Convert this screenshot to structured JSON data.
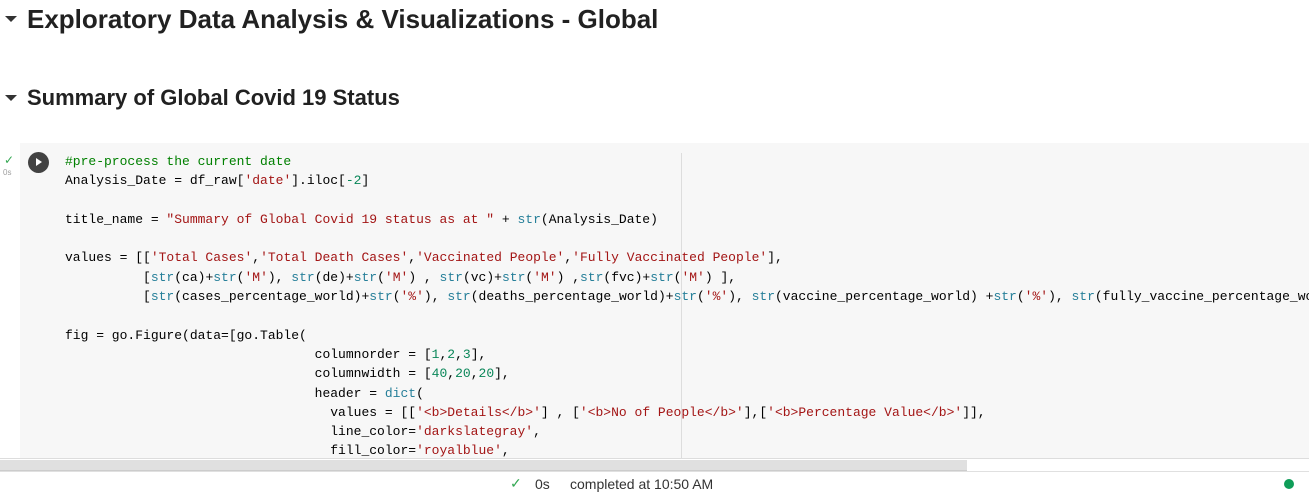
{
  "headings": {
    "h1": "Exploratory Data Analysis & Visualizations - Global",
    "h2": "Summary of Global Covid 19 Status"
  },
  "cell": {
    "status_icon": "check-icon",
    "status_check": "✓",
    "exec_time": "0s",
    "run_icon": "play-icon",
    "code_lines": [
      [
        [
          "c",
          "#pre-process the current date"
        ]
      ],
      [
        [
          "p",
          "Analysis_Date = df_raw["
        ],
        [
          "s",
          "'date'"
        ],
        [
          "p",
          "].iloc["
        ],
        [
          "n",
          "-2"
        ],
        [
          "p",
          "]"
        ]
      ],
      [],
      [
        [
          "p",
          "title_name = "
        ],
        [
          "s",
          "\"Summary of Global Covid 19 status as at \""
        ],
        [
          "p",
          " + "
        ],
        [
          "b",
          "str"
        ],
        [
          "p",
          "(Analysis_Date)"
        ]
      ],
      [],
      [
        [
          "p",
          "values = [["
        ],
        [
          "s",
          "'Total Cases'"
        ],
        [
          "p",
          ","
        ],
        [
          "s",
          "'Total Death Cases'"
        ],
        [
          "p",
          ","
        ],
        [
          "s",
          "'Vaccinated People'"
        ],
        [
          "p",
          ","
        ],
        [
          "s",
          "'Fully Vaccinated People'"
        ],
        [
          "p",
          "],"
        ]
      ],
      [
        [
          "p",
          "          ["
        ],
        [
          "b",
          "str"
        ],
        [
          "p",
          "(ca)+"
        ],
        [
          "b",
          "str"
        ],
        [
          "p",
          "("
        ],
        [
          "s",
          "'M'"
        ],
        [
          "p",
          "), "
        ],
        [
          "b",
          "str"
        ],
        [
          "p",
          "(de)+"
        ],
        [
          "b",
          "str"
        ],
        [
          "p",
          "("
        ],
        [
          "s",
          "'M'"
        ],
        [
          "p",
          ") , "
        ],
        [
          "b",
          "str"
        ],
        [
          "p",
          "(vc)+"
        ],
        [
          "b",
          "str"
        ],
        [
          "p",
          "("
        ],
        [
          "s",
          "'M'"
        ],
        [
          "p",
          ") ,"
        ],
        [
          "b",
          "str"
        ],
        [
          "p",
          "(fvc)+"
        ],
        [
          "b",
          "str"
        ],
        [
          "p",
          "("
        ],
        [
          "s",
          "'M'"
        ],
        [
          "p",
          ") ],"
        ]
      ],
      [
        [
          "p",
          "          ["
        ],
        [
          "b",
          "str"
        ],
        [
          "p",
          "(cases_percentage_world)+"
        ],
        [
          "b",
          "str"
        ],
        [
          "p",
          "("
        ],
        [
          "s",
          "'%'"
        ],
        [
          "p",
          "), "
        ],
        [
          "b",
          "str"
        ],
        [
          "p",
          "(deaths_percentage_world)+"
        ],
        [
          "b",
          "str"
        ],
        [
          "p",
          "("
        ],
        [
          "s",
          "'%'"
        ],
        [
          "p",
          "), "
        ],
        [
          "b",
          "str"
        ],
        [
          "p",
          "(vaccine_percentage_world) +"
        ],
        [
          "b",
          "str"
        ],
        [
          "p",
          "("
        ],
        [
          "s",
          "'%'"
        ],
        [
          "p",
          "), "
        ],
        [
          "b",
          "str"
        ],
        [
          "p",
          "(fully_vaccine_percentage_wor"
        ]
      ],
      [],
      [
        [
          "p",
          "fig = go.Figure(data=[go.Table("
        ]
      ],
      [
        [
          "p",
          "                                columnorder = ["
        ],
        [
          "n",
          "1"
        ],
        [
          "p",
          ","
        ],
        [
          "n",
          "2"
        ],
        [
          "p",
          ","
        ],
        [
          "n",
          "3"
        ],
        [
          "p",
          "],"
        ]
      ],
      [
        [
          "p",
          "                                columnwidth = ["
        ],
        [
          "n",
          "40"
        ],
        [
          "p",
          ","
        ],
        [
          "n",
          "20"
        ],
        [
          "p",
          ","
        ],
        [
          "n",
          "20"
        ],
        [
          "p",
          "],"
        ]
      ],
      [
        [
          "p",
          "                                header = "
        ],
        [
          "b",
          "dict"
        ],
        [
          "p",
          "("
        ]
      ],
      [
        [
          "p",
          "                                  values = [["
        ],
        [
          "s",
          "'<b>Details</b>'"
        ],
        [
          "p",
          "] , ["
        ],
        [
          "s",
          "'<b>No of People</b>'"
        ],
        [
          "p",
          "],["
        ],
        [
          "s",
          "'<b>Percentage Value</b>'"
        ],
        [
          "p",
          "]],"
        ]
      ],
      [
        [
          "p",
          "                                  line_color="
        ],
        [
          "s",
          "'darkslategray'"
        ],
        [
          "p",
          ","
        ]
      ],
      [
        [
          "p",
          "                                  fill_color="
        ],
        [
          "s",
          "'royalblue'"
        ],
        [
          "p",
          ","
        ]
      ]
    ]
  },
  "statusbar": {
    "check": "✓",
    "duration": "0s",
    "text": "completed at 10:50 AM",
    "runtime_status_color": "#0f9d58"
  }
}
